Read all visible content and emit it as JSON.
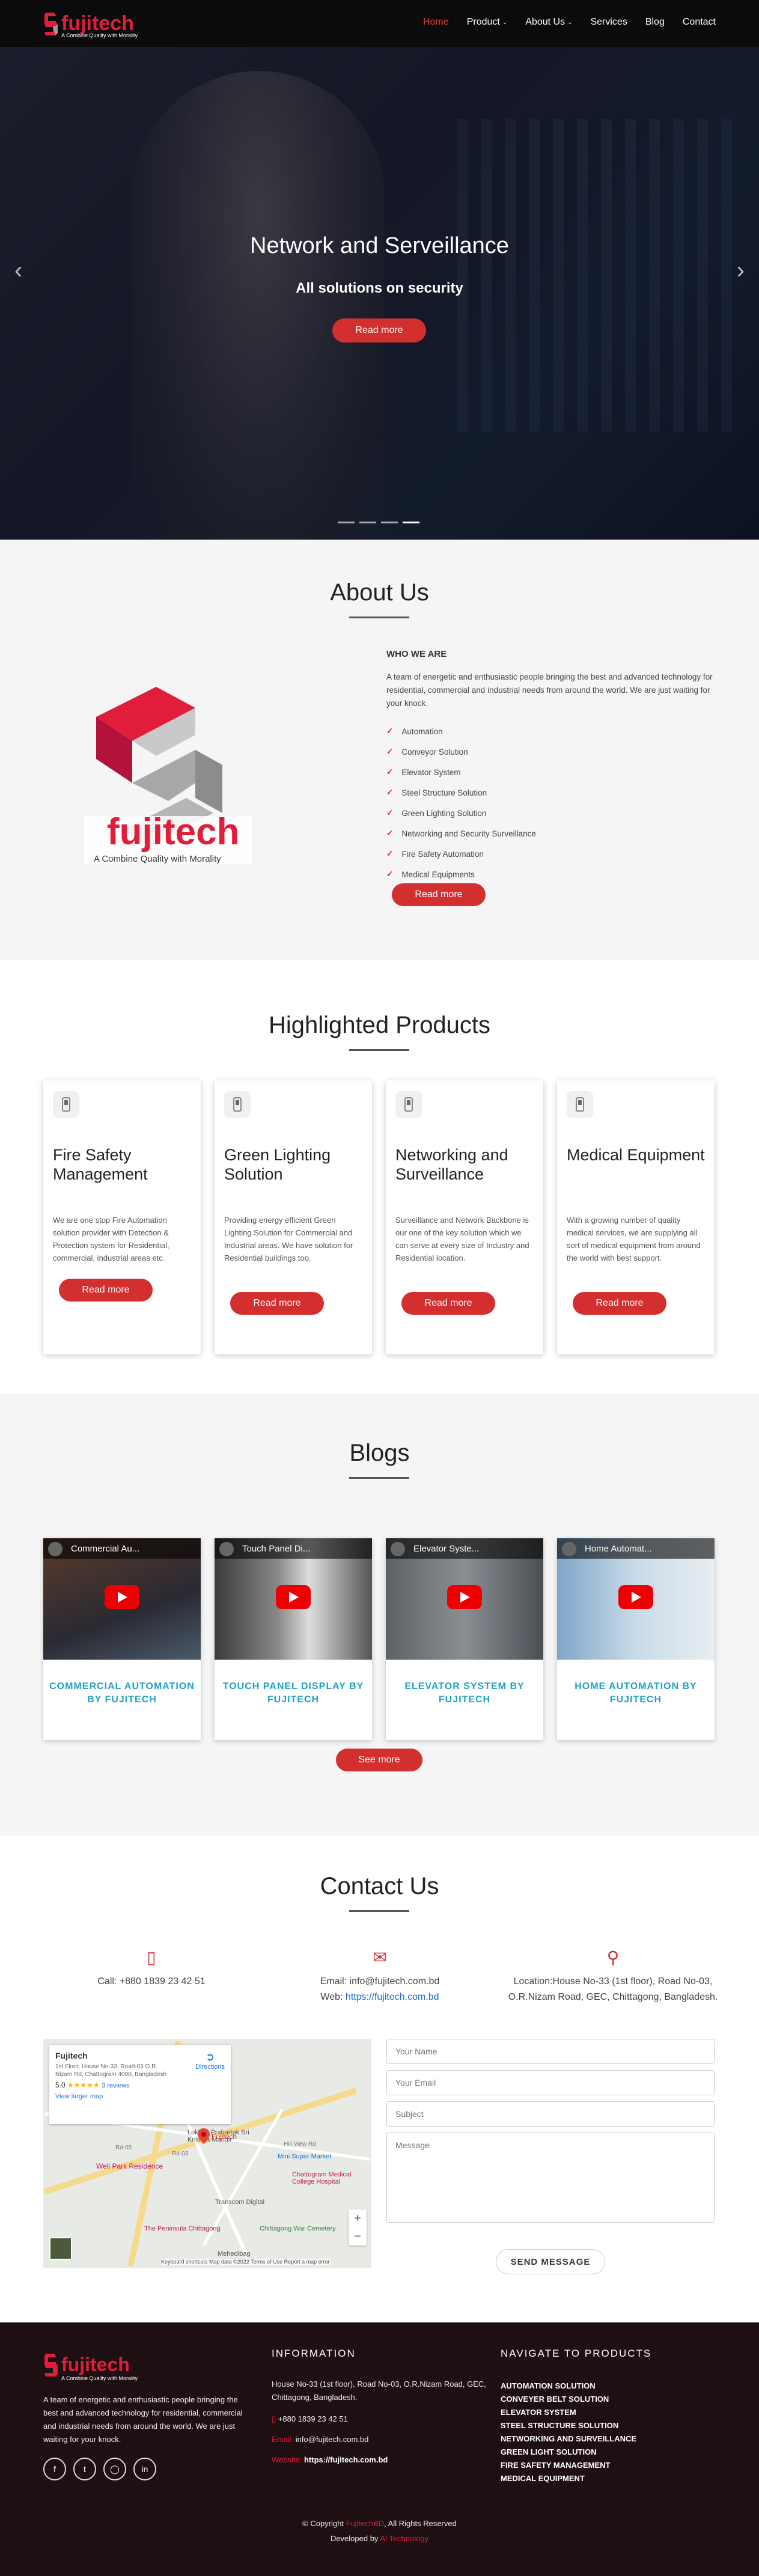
{
  "brand": {
    "name": "fujitech",
    "tagline": "A Combine Quality with Morality"
  },
  "nav": [
    {
      "label": "Home",
      "active": true,
      "dropdown": false
    },
    {
      "label": "Product",
      "active": false,
      "dropdown": true
    },
    {
      "label": "About Us",
      "active": false,
      "dropdown": true
    },
    {
      "label": "Services",
      "active": false,
      "dropdown": false
    },
    {
      "label": "Blog",
      "active": false,
      "dropdown": false
    },
    {
      "label": "Contact",
      "active": false,
      "dropdown": false
    }
  ],
  "hero": {
    "title": "Network and Serveillance",
    "subtitle": "All solutions on security",
    "button": "Read more",
    "prev_icon": "chevron-left-icon",
    "next_icon": "chevron-right-icon",
    "slide_count": 4,
    "active_slide": 4
  },
  "about": {
    "title": "About Us",
    "who_heading": "WHO WE ARE",
    "description": "A team of energetic and enthusiastic people bringing the best and advanced technology for residential, commercial and industrial needs from around the world. We are just waiting for your knock.",
    "items": [
      "Automation",
      "Conveyor Solution",
      "Elevator System",
      "Steel Structure Solution",
      "Green Lighting Solution",
      "Networking and Security Surveillance",
      "Fire Safety Automation",
      "Medical Equipments"
    ],
    "button": "Read more",
    "logo_brand": "fujitech",
    "logo_tagline": "A Combine Quality with Morality"
  },
  "products": {
    "title": "Highlighted Products",
    "cards": [
      {
        "title": "Fire Safety Management",
        "description": "We are one stop Fire Automation solution provider with Detection & Protection system for Residential, commercial, industrial areas etc.",
        "button": "Read more"
      },
      {
        "title": "Green Lighting Solution",
        "description": "Providing energy efficient Green Lighting Solution for Commercial and Industrial areas. We have solution for Residential buildings too.",
        "button": "Read more"
      },
      {
        "title": "Networking and Surveillance",
        "description": "Surveillance and Network Backbone is our one of the key solution which we can serve at every size of Industry and Residential location.",
        "button": "Read more"
      },
      {
        "title": "Medical Equipment",
        "description": "With a growing number of quality medical services, we are supplying all sort of medical equipment from around the world with best support.",
        "button": "Read more"
      }
    ]
  },
  "blogs": {
    "title": "Blogs",
    "posts": [
      {
        "video_title": "Commercial Au...",
        "title": "COMMERCIAL AUTOMATION BY FUJITECH"
      },
      {
        "video_title": "Touch Panel Di...",
        "title": "TOUCH PANEL DISPLAY BY FUJITECH"
      },
      {
        "video_title": "Elevator Syste...",
        "title": "ELEVATOR SYSTEM BY FUJITECH"
      },
      {
        "video_title": "Home Automat...",
        "title": "HOME AUTOMATION BY FUJITECH"
      }
    ],
    "button": "See more"
  },
  "contact": {
    "title": "Contact Us",
    "phone": "Call: +880 1839 23 42 51",
    "email": "Email: info@fujitech.com.bd",
    "web_label": "Web: ",
    "web_link": "https://fujitech.com.bd",
    "location": "Location:House No-33 (1st floor), Road No-03, O.R.Nizam Road, GEC, Chittagong, Bangladesh.",
    "map": {
      "place": "Fujitech",
      "address": "1st Floor, House No-33, Road-03 O.R. Nizam Rd, Chattogram 4000, Bangladesh",
      "rating": "5.0",
      "stars": "★★★★★",
      "reviews": "3 reviews",
      "larger": "View larger map",
      "directions": "Directions",
      "pin_label": "Fujitech",
      "labels": [
        "Lokkon Prabartak Sri Krishna Mandir",
        "Mini Super Market",
        "Well Park Residence",
        "Chattogram Medical College Hospital",
        "Transcom Digital",
        "The Peninsula Chittagong",
        "Chittagong War Cemetery",
        "Mehedibag",
        "Hill View Rd",
        "Rd-03",
        "Rd-05"
      ],
      "footer": "Keyboard shortcuts   Map data ©2022   Terms of Use   Report a map error",
      "zoom_in": "+",
      "zoom_out": "−"
    },
    "form": {
      "name": "Your Name",
      "email": "Your Email",
      "subject": "Subject",
      "message": "Message",
      "button": "SEND MESSAGE"
    }
  },
  "footer": {
    "about": "A team of energetic and enthusiastic people bringing the best and advanced technology for residential, commercial and industrial needs from around the world. We are just waiting for your knock.",
    "info_title": "INFORMATION",
    "address": "House No-33 (1st floor), Road No-03, O.R.Nizam Road, GEC, Chittagong, Bangladesh.",
    "phone": "+880 1839 23 42 51",
    "email_label": "Email:",
    "email": "info@fujitech.com.bd",
    "website_label": "Website:",
    "website": "https://fujitech.com.bd",
    "nav_title": "NAVIGATE TO PRODUCTS",
    "nav_items": [
      "AUTOMATION SOLUTION",
      "CONVEYER BELT SOLUTION",
      "ELEVATOR SYSTEM",
      "STEEL STRUCTURE SOLUTION",
      "NETWORKING AND SURVEILLANCE",
      "GREEN LIGHT SOLUTION",
      "FIRE SAFETY MANAGEMENT",
      "MEDICAL EQUIPMENT"
    ],
    "copyright_pre": "© Copyright ",
    "copyright_brand": "FujitechBD",
    "copyright_post": ", All Rights Reserved",
    "dev_pre": "Developed by ",
    "dev_brand": "Al Technology",
    "social": [
      "facebook-icon",
      "twitter-icon",
      "instagram-icon",
      "linkedin-icon"
    ]
  },
  "colors": {
    "accent": "#d32f2f",
    "brand": "#e01e3c",
    "header_bg": "#0b0b0d",
    "footer_bg": "#1e0f12",
    "blog_title": "#1fa1c8"
  }
}
